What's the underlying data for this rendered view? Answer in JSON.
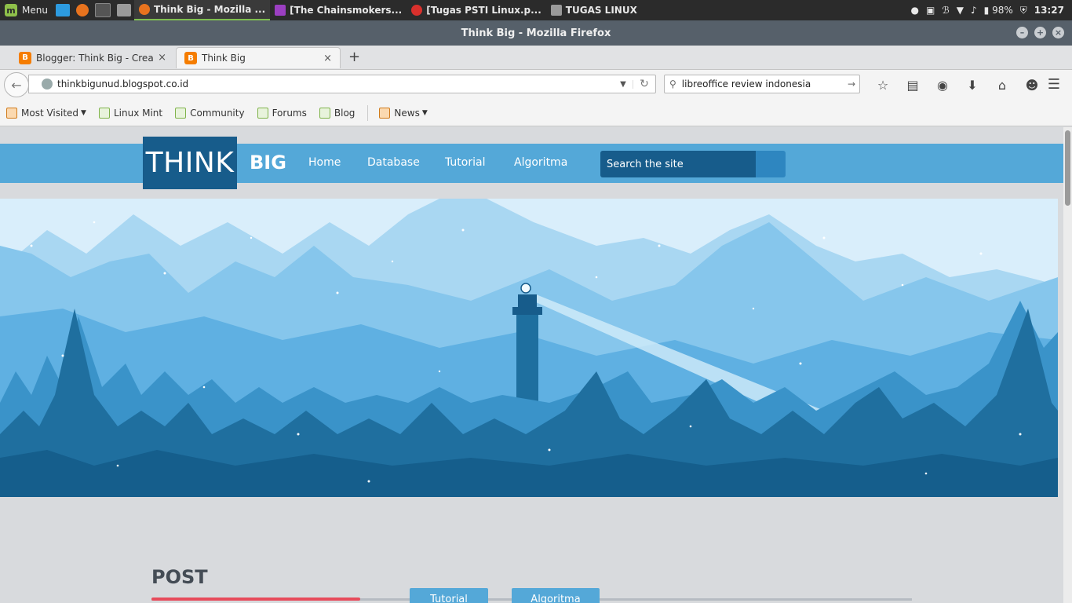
{
  "os_panel": {
    "menu_label": "Menu",
    "tasks": [
      {
        "label": "Think Big - Mozilla ...",
        "icon": "firefox-icon"
      },
      {
        "label": "[The Chainsmokers...",
        "icon": "media-player-icon"
      },
      {
        "label": "[Tugas PSTI Linux.p...",
        "icon": "document-viewer-icon"
      },
      {
        "label": "TUGAS LINUX",
        "icon": "folder-icon"
      }
    ],
    "battery": "98%",
    "clock": "13:27"
  },
  "window": {
    "title": "Think Big - Mozilla Firefox"
  },
  "tabs": [
    {
      "label": "Blogger: Think Big - Creat...",
      "active": false
    },
    {
      "label": "Think Big",
      "active": true
    }
  ],
  "navbar": {
    "url": "thinkbigunud.blogspot.co.id",
    "search_value": "libreoffice review indonesia"
  },
  "bookmarks": [
    {
      "label": "Most Visited",
      "dropdown": true
    },
    {
      "label": "Linux Mint"
    },
    {
      "label": "Community"
    },
    {
      "label": "Forums"
    },
    {
      "label": "Blog"
    },
    {
      "label": "News",
      "dropdown": true
    }
  ],
  "site": {
    "logo_think": "THINK",
    "logo_big": "BIG",
    "nav": [
      "Home",
      "Database",
      "Tutorial",
      "Algoritma"
    ],
    "search_placeholder": "Search the site",
    "post_heading": "POST",
    "post_tabs": [
      "Tutorial",
      "Algoritma"
    ]
  },
  "colors": {
    "site_nav": "#54a8d8",
    "logo_bg": "#175c8b",
    "accent_red": "#e74b5b"
  }
}
